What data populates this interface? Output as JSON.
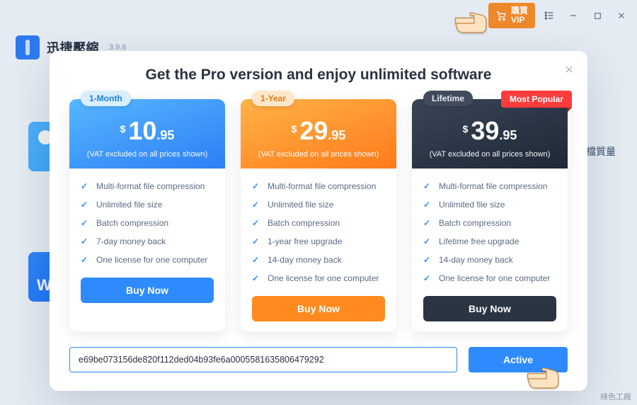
{
  "titlebar": {
    "vip_label": "購買\nVIP"
  },
  "app": {
    "name": "迅捷壓縮",
    "version": "3.9.6"
  },
  "side_text": "檔質量",
  "modal": {
    "title": "Get the Pro version and enjoy unlimited software",
    "license_value": "e69be073156de820f112ded04b93fe6a0005581635806479292",
    "active_label": "Active"
  },
  "plans": [
    {
      "badge": "1-Month",
      "currency": "$",
      "price_int": "10",
      "price_dec": ".95",
      "vat": "(VAT excluded on all prices shown)",
      "buy": "Buy Now",
      "features": [
        "Multi-format file compression",
        "Unlimited file size",
        "Batch compression",
        "7-day money back",
        "One license for one computer"
      ]
    },
    {
      "badge": "1-Year",
      "currency": "$",
      "price_int": "29",
      "price_dec": ".95",
      "vat": "(VAT excluded on all prices shown)",
      "buy": "Buy Now",
      "features": [
        "Multi-format file compression",
        "Unlimited file size",
        "Batch compression",
        "1-year free upgrade",
        "14-day money back",
        "One license for one computer"
      ]
    },
    {
      "badge": "Lifetime",
      "ribbon": "Most Popular",
      "currency": "$",
      "price_int": "39",
      "price_dec": ".95",
      "vat": "(VAT excluded on all prices shown)",
      "buy": "Buy Now",
      "features": [
        "Multi-format file compression",
        "Unlimited file size",
        "Batch compression",
        "Lifetime free upgrade",
        "14-day money back",
        "One license for one computer"
      ]
    }
  ],
  "watermark": "綠色工廠"
}
